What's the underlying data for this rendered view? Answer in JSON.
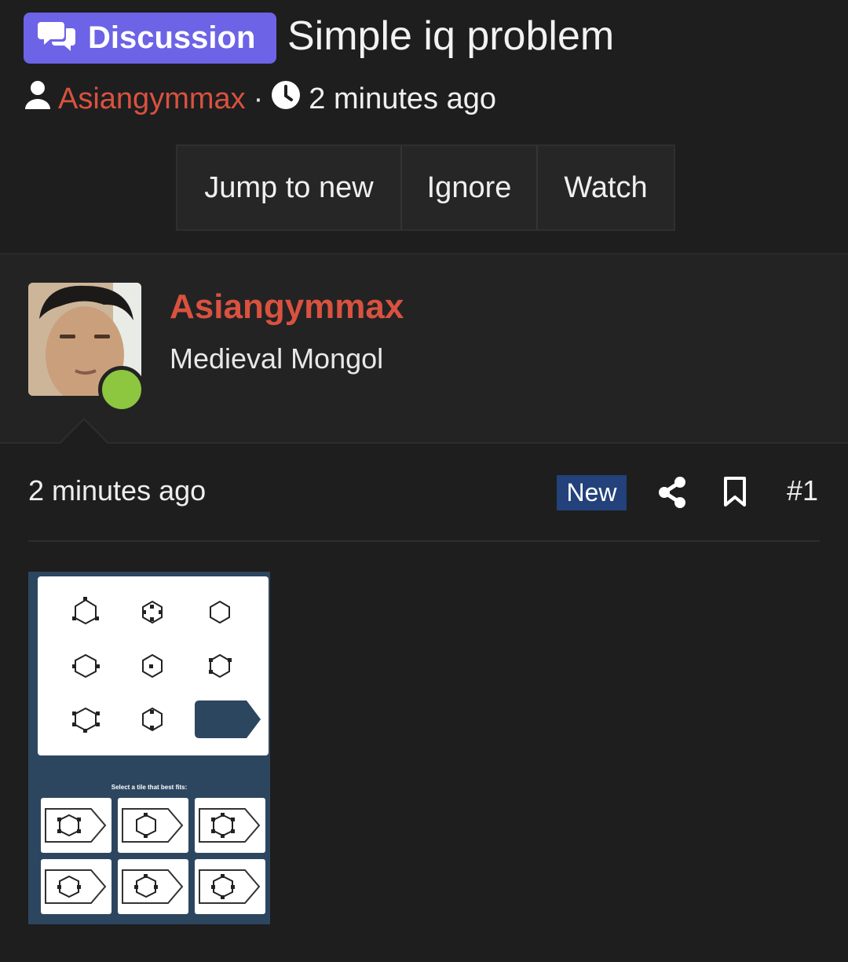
{
  "thread": {
    "badge_label": "Discussion",
    "title": "Simple iq problem",
    "author": "Asiangymmax",
    "separator": "·",
    "time": "2 minutes ago"
  },
  "actions": [
    "Jump to new",
    "Ignore",
    "Watch"
  ],
  "post": {
    "author": "Asiangymmax",
    "author_title": "Medieval Mongol",
    "online": true,
    "time": "2 minutes ago",
    "new_label": "New",
    "number": "#1",
    "attachment": {
      "caption": "Select a tile that best fits:"
    }
  },
  "colors": {
    "accent_badge": "#6d63e6",
    "author_link": "#d9523f",
    "new_badge": "#23417a",
    "online": "#8dc63f"
  },
  "icons": [
    "chat-bubbles-icon",
    "user-icon",
    "clock-icon",
    "share-icon",
    "bookmark-icon"
  ]
}
